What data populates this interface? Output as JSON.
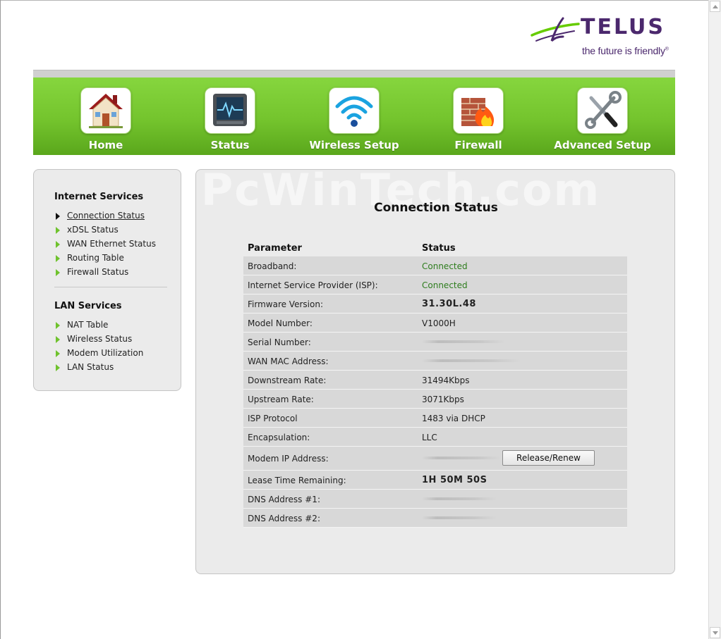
{
  "brand": {
    "name": "TELUS",
    "tagline": "the future is friendly",
    "trademark": "®",
    "colors": {
      "purple": "#4b286d",
      "green": "#66cc00"
    }
  },
  "nav": {
    "items": [
      {
        "label": "Home",
        "icon": "home-icon"
      },
      {
        "label": "Status",
        "icon": "monitor-icon"
      },
      {
        "label": "Wireless Setup",
        "icon": "wifi-icon"
      },
      {
        "label": "Firewall",
        "icon": "firewall-icon"
      },
      {
        "label": "Advanced Setup",
        "icon": "tools-icon"
      }
    ]
  },
  "sidebar": {
    "internet_heading": "Internet Services",
    "internet_items": [
      {
        "label": "Connection Status",
        "active": true
      },
      {
        "label": "xDSL Status"
      },
      {
        "label": "WAN Ethernet Status"
      },
      {
        "label": "Routing Table"
      },
      {
        "label": "Firewall Status"
      }
    ],
    "lan_heading": "LAN Services",
    "lan_items": [
      {
        "label": "NAT Table"
      },
      {
        "label": "Wireless Status"
      },
      {
        "label": "Modem Utilization"
      },
      {
        "label": "LAN Status"
      }
    ]
  },
  "main": {
    "watermark": "PcWinTech.com",
    "title": "Connection Status",
    "table": {
      "headers": [
        "Parameter",
        "Status"
      ],
      "rows": [
        {
          "param": "Broadband:",
          "value": "Connected"
        },
        {
          "param": "Internet Service Provider (ISP):",
          "value": "Connected"
        },
        {
          "param": "Firmware Version:",
          "value": "31.30L.48"
        },
        {
          "param": "Model Number:",
          "value": "V1000H"
        },
        {
          "param": "Serial Number:",
          "value": ""
        },
        {
          "param": "WAN MAC Address:",
          "value": ""
        },
        {
          "param": "Downstream Rate:",
          "value": "31494Kbps"
        },
        {
          "param": "Upstream Rate:",
          "value": "3071Kbps"
        },
        {
          "param": "ISP Protocol",
          "value": "1483 via DHCP"
        },
        {
          "param": "Encapsulation:",
          "value": "LLC"
        },
        {
          "param": "Modem IP Address:",
          "value": ""
        },
        {
          "param": "Lease Time Remaining:",
          "value": "1H 50M 50S"
        },
        {
          "param": "DNS Address #1:",
          "value": ""
        },
        {
          "param": "DNS Address #2:",
          "value": ""
        }
      ]
    },
    "release_button": "Release/Renew"
  }
}
